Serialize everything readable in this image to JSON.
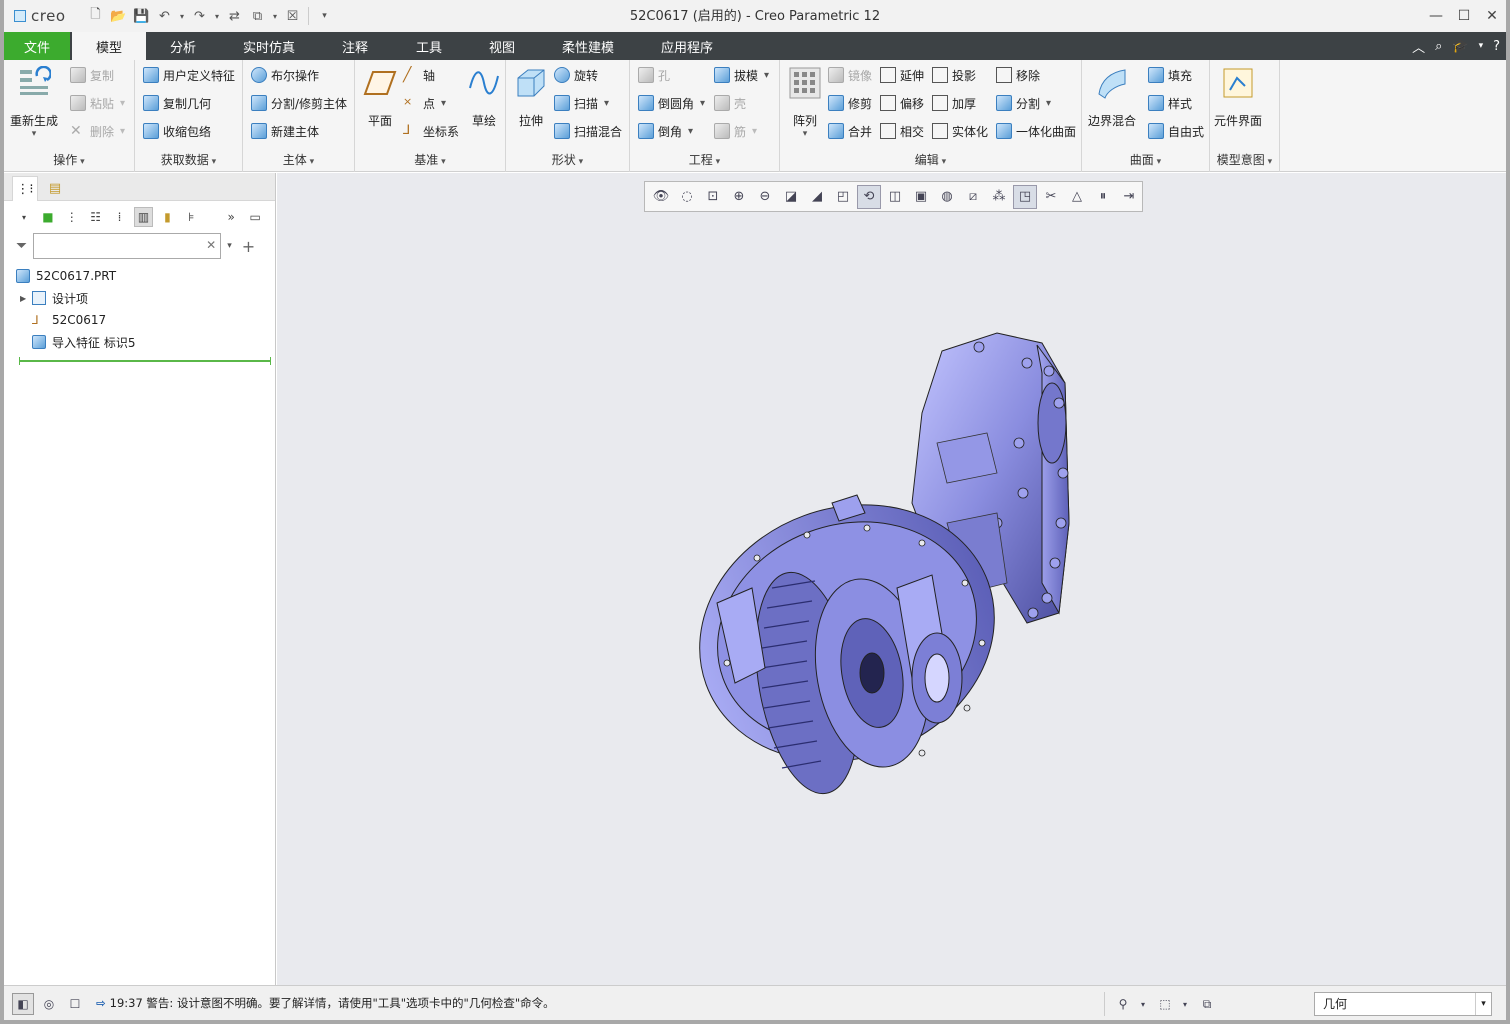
{
  "app": {
    "logo": "creo",
    "window_title": "52C0617 (启用的) - Creo Parametric 12"
  },
  "ribbon_tabs": [
    "文件",
    "模型",
    "分析",
    "实时仿真",
    "注释",
    "工具",
    "视图",
    "柔性建模",
    "应用程序"
  ],
  "active_tab": "模型",
  "groups": {
    "operations": {
      "label": "操作",
      "regenerate": "重新生成",
      "copy": "复制",
      "paste": "粘贴",
      "delete": "删除"
    },
    "get_data": {
      "label": "获取数据",
      "user_feature": "用户定义特征",
      "copy_geom": "复制几何",
      "shrinkwrap": "收缩包络"
    },
    "body": {
      "label": "主体",
      "boolean": "布尔操作",
      "split_trim": "分割/修剪主体",
      "new_body": "新建主体"
    },
    "datum": {
      "label": "基准",
      "plane": "平面",
      "axis": "轴",
      "point": "点",
      "csys": "坐标系",
      "sketch": "草绘"
    },
    "shapes": {
      "label": "形状",
      "extrude": "拉伸",
      "revolve": "旋转",
      "sweep": "扫描",
      "swept_blend": "扫描混合"
    },
    "engineering": {
      "label": "工程",
      "hole": "孔",
      "round": "倒圆角",
      "chamfer": "倒角",
      "draft": "拔模",
      "shell": "壳",
      "rib": "筋"
    },
    "editing": {
      "label": "编辑",
      "pattern": "阵列",
      "mirror": "镜像",
      "extend": "延伸",
      "project": "投影",
      "move": "移除",
      "trim": "修剪",
      "offset": "偏移",
      "thicken": "加厚",
      "split": "分割",
      "merge": "合并",
      "intersect": "相交",
      "solidify": "实体化",
      "unify": "一体化曲面"
    },
    "surfaces": {
      "label": "曲面",
      "boundary": "边界混合",
      "fill": "填充",
      "style": "样式",
      "freestyle": "自由式"
    },
    "model_intent": {
      "label": "模型意图",
      "component_interface": "元件界面"
    }
  },
  "model_tree": {
    "search_placeholder": "",
    "root": "52C0617.PRT",
    "items": [
      "设计项",
      "52C0617",
      "导入特征 标识5"
    ]
  },
  "status": {
    "message": "19:37 警告: 设计意图不明确。要了解详情，请使用\"工具\"选项卡中的\"几何检查\"命令。",
    "filter_value": "几何"
  }
}
